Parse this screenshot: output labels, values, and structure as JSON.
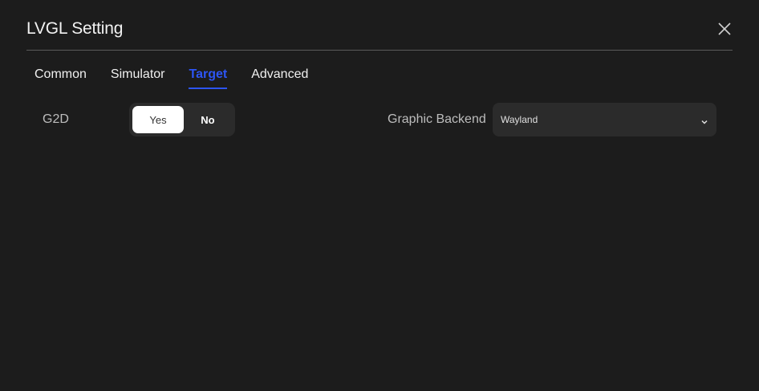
{
  "dialog": {
    "title": "LVGL Setting",
    "close_icon": "close-icon"
  },
  "tabs": [
    {
      "label": "Common",
      "active": false
    },
    {
      "label": "Simulator",
      "active": false
    },
    {
      "label": "Target",
      "active": true
    },
    {
      "label": "Advanced",
      "active": false
    }
  ],
  "target": {
    "g2d": {
      "label": "G2D",
      "options": [
        "Yes",
        "No"
      ],
      "selected": "Yes"
    },
    "graphic_backend": {
      "label": "Graphic Backend",
      "value": "Wayland",
      "icon": "chevron-down-icon"
    }
  },
  "colors": {
    "background": "#1c1c1c",
    "accent": "#2d55f5",
    "control_bg": "#2b2b2b"
  }
}
